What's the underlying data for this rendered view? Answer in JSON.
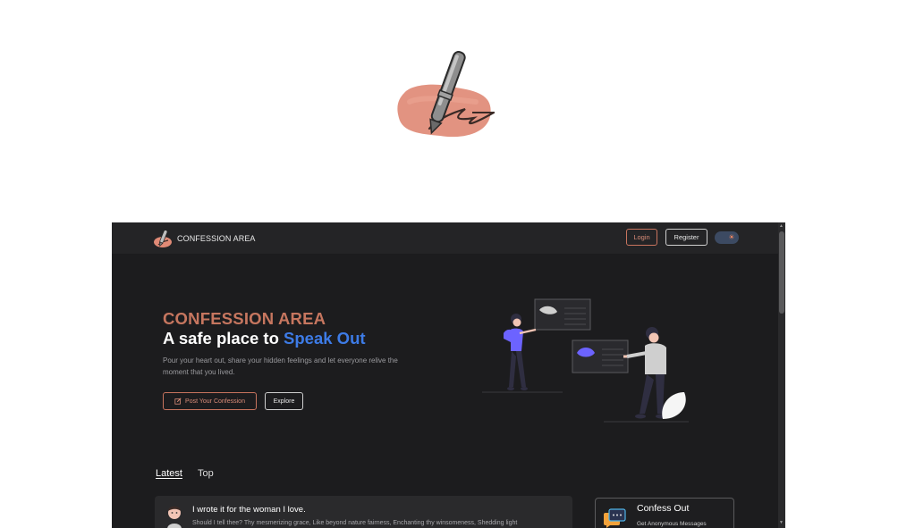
{
  "navbar": {
    "brand": "CONFESSION AREA",
    "login": "Login",
    "register": "Register",
    "theme_icon": "sun-icon"
  },
  "hero": {
    "title": "CONFESSION AREA",
    "subtitle_prefix": "A safe place to ",
    "subtitle_accent": "Speak Out",
    "description": "Pour your heart out, share your hidden feelings and let everyone relive the moment that you lived.",
    "post_button": "Post Your Confession",
    "explore_button": "Explore"
  },
  "tabs": [
    {
      "label": "Latest",
      "active": true
    },
    {
      "label": "Top",
      "active": false
    }
  ],
  "posts": [
    {
      "title": "I wrote it for the woman I love.",
      "excerpt": "Should I tell thee? Thy mesmerizing grace, Like beyond nature fairness, Enchanting thy winsomeness, Shedding light"
    }
  ],
  "sidebar_card": {
    "title": "Confess Out",
    "subtitle": "Get Anonymous Messages"
  },
  "colors": {
    "accent": "#c6765f",
    "link_blue": "#3d7be6",
    "background": "#1c1c1e",
    "navbar": "#242426"
  }
}
